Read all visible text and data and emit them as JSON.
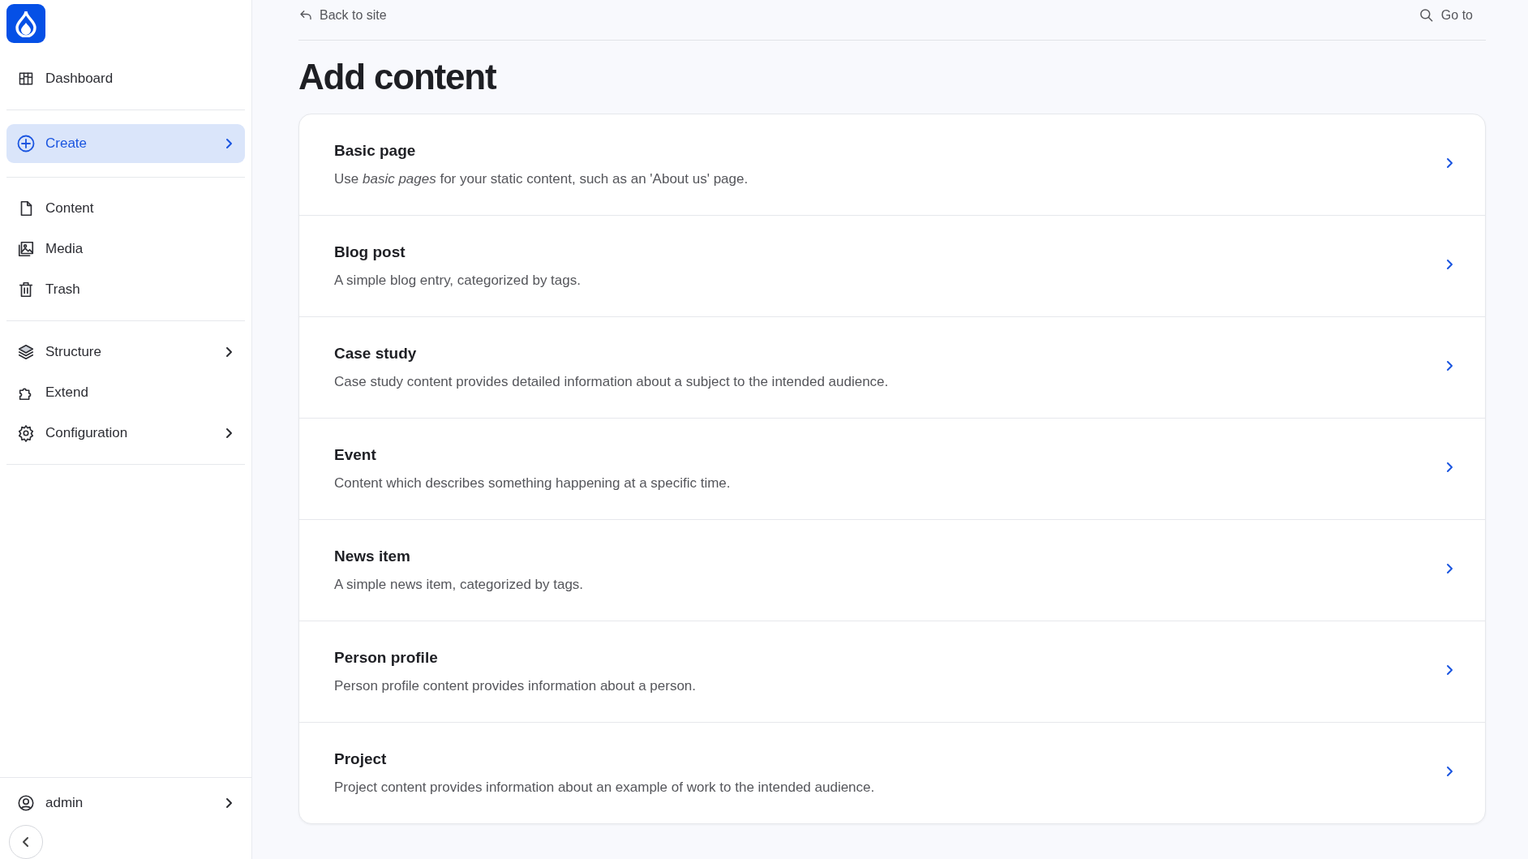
{
  "sidebar": {
    "groups": [
      {
        "items": [
          {
            "label": "Dashboard",
            "selected": false,
            "expandable": false
          }
        ]
      },
      {
        "items": [
          {
            "label": "Create",
            "selected": true,
            "expandable": true
          }
        ]
      },
      {
        "items": [
          {
            "label": "Content",
            "selected": false,
            "expandable": false
          },
          {
            "label": "Media",
            "selected": false,
            "expandable": false
          },
          {
            "label": "Trash",
            "selected": false,
            "expandable": false
          }
        ]
      },
      {
        "items": [
          {
            "label": "Structure",
            "selected": false,
            "expandable": true
          },
          {
            "label": "Extend",
            "selected": false,
            "expandable": false
          },
          {
            "label": "Configuration",
            "selected": false,
            "expandable": true
          }
        ]
      }
    ],
    "user": {
      "label": "admin",
      "expandable": true
    }
  },
  "header": {
    "back_link": "Back to site",
    "goto": "Go to"
  },
  "page_title": "Add content",
  "content_types": [
    {
      "title": "Basic page",
      "description": "Use *basic pages* for your static content, such as an 'About us' page."
    },
    {
      "title": "Blog post",
      "description": "A simple blog entry, categorized by tags."
    },
    {
      "title": "Case study",
      "description": "Case study content provides detailed information about a subject to the intended audience."
    },
    {
      "title": "Event",
      "description": "Content which describes something happening at a specific time."
    },
    {
      "title": "News item",
      "description": "A simple news item, categorized by tags."
    },
    {
      "title": "Person profile",
      "description": "Person profile content provides information about a person."
    },
    {
      "title": "Project",
      "description": "Project content provides information about an example of work to the intended audience."
    }
  ]
}
